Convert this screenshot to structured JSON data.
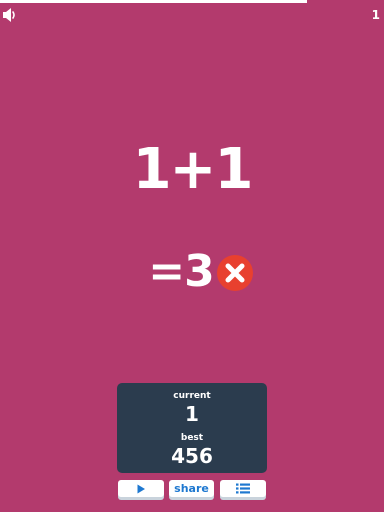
{
  "game": {
    "level": "1",
    "progress_fraction": 0.8,
    "question": "1+1",
    "answer": "=3",
    "answer_status": "wrong"
  },
  "score": {
    "current_label": "current",
    "current_value": "1",
    "best_label": "best",
    "best_value": "456"
  },
  "buttons": {
    "play_icon": "play-icon",
    "share_label": "share",
    "leaderboard_icon": "list-icon"
  },
  "icons": {
    "sound": "speaker-icon",
    "wrong": "x-circle-icon"
  },
  "colors": {
    "background": "#b33a6d",
    "panel": "#2b3c4e",
    "wrong": "#e8402f",
    "button_text": "#1e78d0",
    "text": "#ffffff"
  }
}
